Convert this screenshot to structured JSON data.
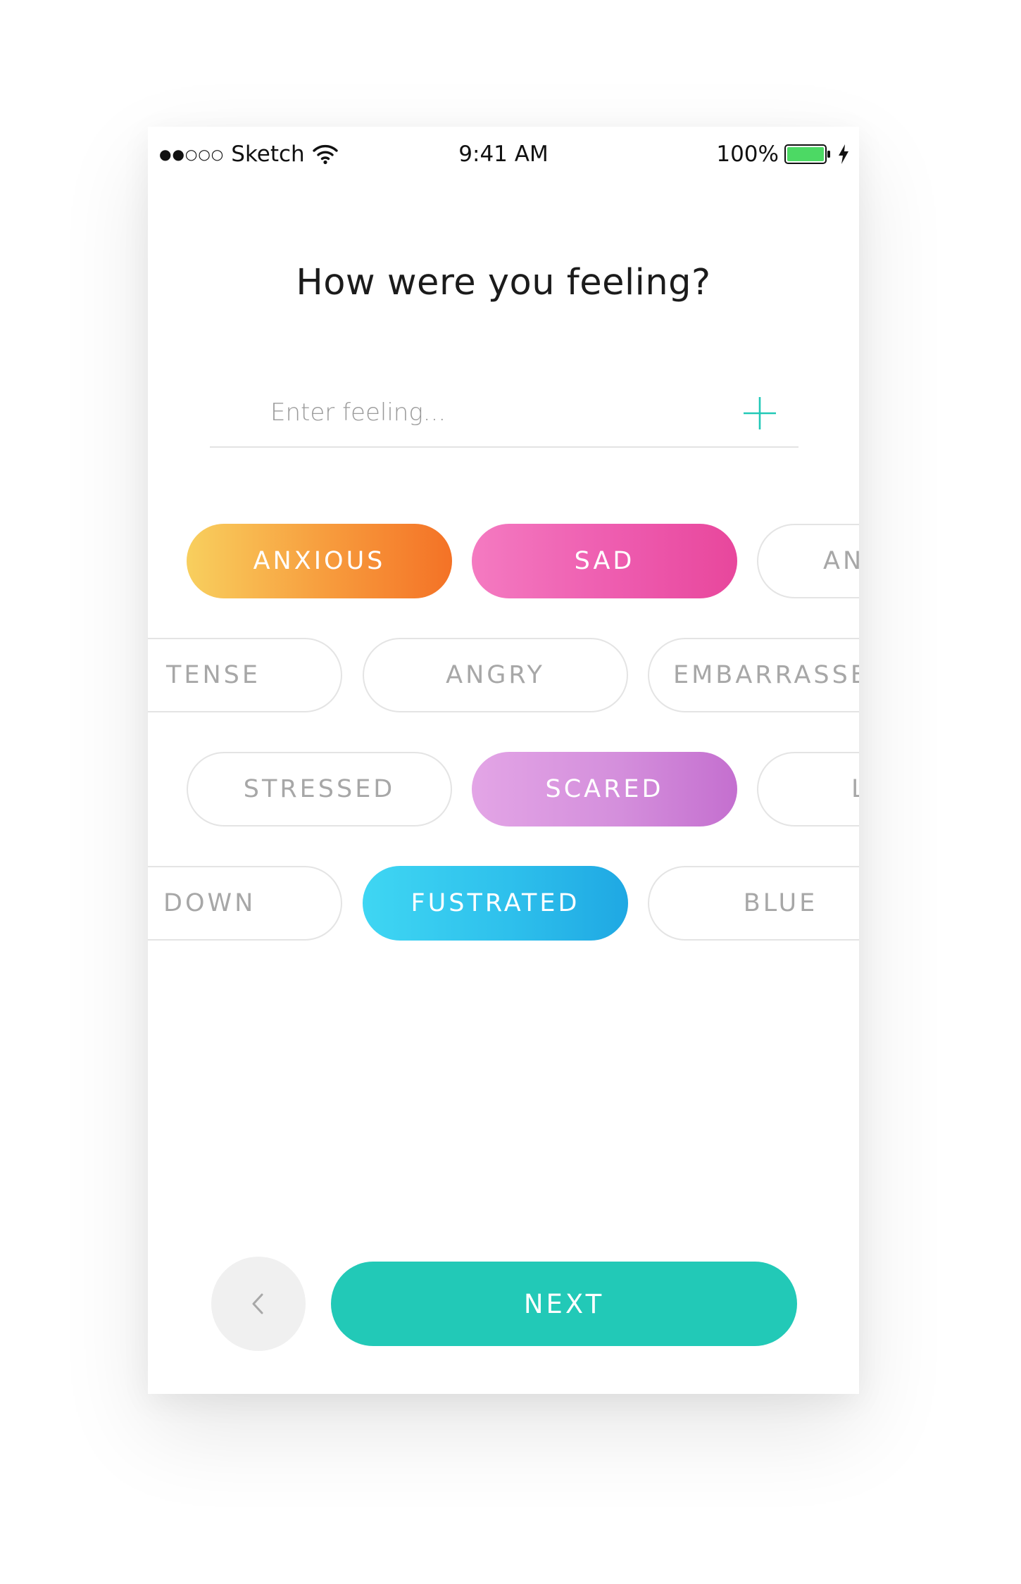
{
  "status_bar": {
    "signal": "●●○○○",
    "carrier": "Sketch",
    "time": "9:41 AM",
    "battery": "100%"
  },
  "title": "How were you feeling?",
  "feeling_input": {
    "placeholder": "Enter feeling...",
    "value": ""
  },
  "chips": {
    "row1": [
      "ANXIOUS",
      "SAD",
      "AN"
    ],
    "row2": [
      "TENSE",
      "ANGRY",
      "EMBARRASSE"
    ],
    "row3": [
      "STRESSED",
      "SCARED",
      "L"
    ],
    "row4": [
      "DOWN",
      "FUSTRATED",
      "BLUE"
    ]
  },
  "selected": [
    "ANXIOUS",
    "SAD",
    "SCARED",
    "FUSTRATED"
  ],
  "buttons": {
    "next": "NEXT"
  },
  "icons": {
    "add": "plus-icon",
    "back": "chevron-left-icon",
    "wifi": "wifi-icon",
    "battery": "battery-icon",
    "charging": "lightning-icon"
  },
  "colors": {
    "accent": "#22c9b7",
    "chip_outline": "#e4e4e4",
    "chip_text": "#a7a7a7"
  }
}
